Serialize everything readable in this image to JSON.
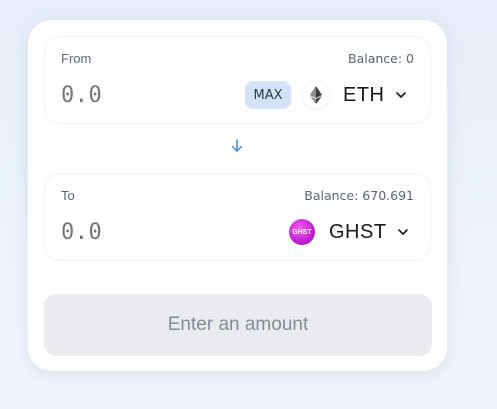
{
  "from": {
    "label": "From",
    "balance": "Balance: 0",
    "amount_placeholder": "0.0",
    "max_label": "MAX",
    "token": {
      "symbol": "ETH",
      "icon": "eth-logo-icon"
    }
  },
  "to": {
    "label": "To",
    "balance": "Balance: 670.691",
    "amount_placeholder": "0.0",
    "token": {
      "symbol": "GHST",
      "icon": "ghst-logo-icon",
      "icon_text": "GHST"
    }
  },
  "swap_arrow": {
    "icon": "arrow-down-icon",
    "color": "#3a8ee6"
  },
  "submit": {
    "label": "Enter an amount"
  },
  "colors": {
    "max_bg": "#d3e3f7",
    "submit_bg": "#e9ebef",
    "ghst_brand": "#c21fd6"
  }
}
